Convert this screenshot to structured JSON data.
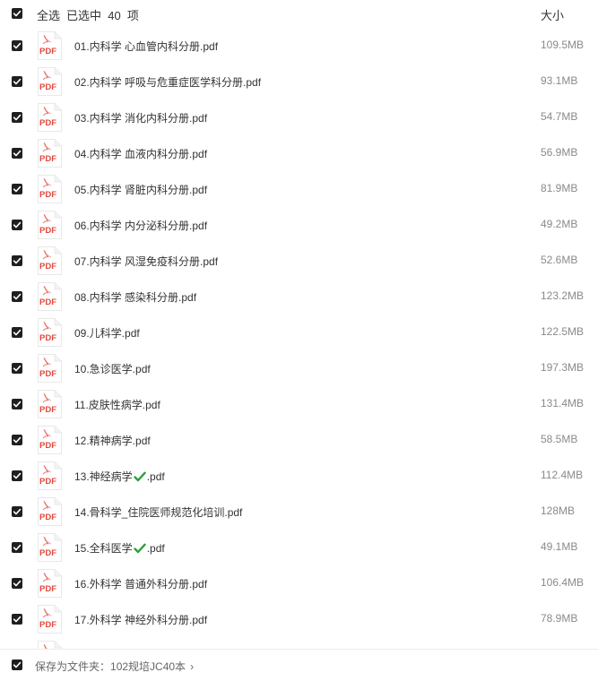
{
  "header": {
    "select_all_label": "全选",
    "selected_text": "已选中  40  项",
    "size_column_label": "大小"
  },
  "files": [
    {
      "name": "01.内科学 心血管内科分册.pdf",
      "size": "109.5MB",
      "checked": true
    },
    {
      "name": "02.内科学 呼吸与危重症医学科分册.pdf",
      "size": "93.1MB",
      "checked": true
    },
    {
      "name": "03.内科学 消化内科分册.pdf",
      "size": "54.7MB",
      "checked": true
    },
    {
      "name": "04.内科学 血液内科分册.pdf",
      "size": "56.9MB",
      "checked": true
    },
    {
      "name": "05.内科学 肾脏内科分册.pdf",
      "size": "81.9MB",
      "checked": true
    },
    {
      "name": "06.内科学 内分泌科分册.pdf",
      "size": "49.2MB",
      "checked": true
    },
    {
      "name": "07.内科学 风湿免疫科分册.pdf",
      "size": "52.6MB",
      "checked": true
    },
    {
      "name": "08.内科学 感染科分册.pdf",
      "size": "123.2MB",
      "checked": true
    },
    {
      "name": "09.儿科学.pdf",
      "size": "122.5MB",
      "checked": true
    },
    {
      "name": "10.急诊医学.pdf",
      "size": "197.3MB",
      "checked": true
    },
    {
      "name": "11.皮肤性病学.pdf",
      "size": "131.4MB",
      "checked": true
    },
    {
      "name": "12.精神病学.pdf",
      "size": "58.5MB",
      "checked": true
    },
    {
      "name_before": "13.神经病学",
      "name_after": ".pdf",
      "has_check_emoji": true,
      "size": "112.4MB",
      "checked": true
    },
    {
      "name": "14.骨科学_住院医师规范化培训.pdf",
      "size": "128MB",
      "checked": true
    },
    {
      "name_before": "15.全科医学",
      "name_after": ".pdf",
      "has_check_emoji": true,
      "size": "49.1MB",
      "checked": true
    },
    {
      "name": "16.外科学 普通外科分册.pdf",
      "size": "106.4MB",
      "checked": true
    },
    {
      "name": "17.外科学 神经外科分册.pdf",
      "size": "78.9MB",
      "checked": true
    }
  ],
  "icon": {
    "file_type_label": "PDF",
    "file_type_color": "#e04a3f"
  },
  "footer": {
    "save_to_label": "保存为文件夹：",
    "folder_name": "102规培JC40本",
    "chevron": "›"
  },
  "colors": {
    "checkbox": "#1f1f1f",
    "check_emoji": "#2e9e3a",
    "size_text": "#8a8a8a"
  }
}
